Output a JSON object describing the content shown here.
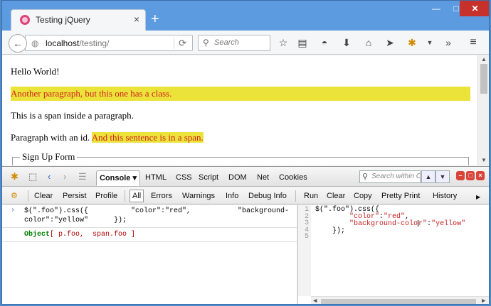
{
  "browser": {
    "tab_title": "Testing jQuery",
    "tab_close": "×",
    "new_tab": "+",
    "win_min": "—",
    "win_max": "□",
    "win_close": "✕",
    "url_host": "localhost",
    "url_path": "/testing/",
    "search_placeholder": "Search",
    "nav_icons": [
      "star-icon",
      "reading-list-icon",
      "pocket-icon",
      "download-icon",
      "home-icon",
      "share-icon",
      "firebug-icon",
      "menu-dropdown-icon",
      "overflow-icon",
      "hamburger-menu-icon"
    ]
  },
  "page": {
    "p1": "Hello World!",
    "p_foo": "Another paragraph, but this one has a class.",
    "p3": "This is a span inside a paragraph.",
    "p4_text": "Paragraph with an id. ",
    "p4_span": "And this sentence is in a span.",
    "fieldset_legend": "Sign Up Form"
  },
  "firebug": {
    "tabs": [
      "Console ▾",
      "HTML",
      "CSS",
      "Script",
      "DOM",
      "Net",
      "Cookies"
    ],
    "active_tab": "Console ▾",
    "search_placeholder": "Search within C",
    "sub_left": [
      "Clear",
      "Persist",
      "Profile"
    ],
    "filters": [
      "All",
      "Errors",
      "Warnings",
      "Info",
      "Debug Info"
    ],
    "sub_right": [
      "Run",
      "Clear",
      "Copy",
      "Pretty Print",
      "History"
    ],
    "log": {
      "caret": "›",
      "command_line1": "$(\".foo\").css({          \"color\":\"red\",           \"background-",
      "command_line2": "color\":\"yellow\"      });",
      "result_type": "Object",
      "result_items": "[ p.foo,  span.foo ]"
    },
    "editor": {
      "line_numbers": [
        "1",
        "2",
        "3",
        "4",
        "5"
      ],
      "line1": "$(\".foo\").css({",
      "line2_key": "\"color\"",
      "line2_val": "\"red\"",
      "line3_key_a": "\"background-colo",
      "line3_key_b": "r\"",
      "line3_val": "\"yellow\"",
      "line4": "});"
    }
  }
}
